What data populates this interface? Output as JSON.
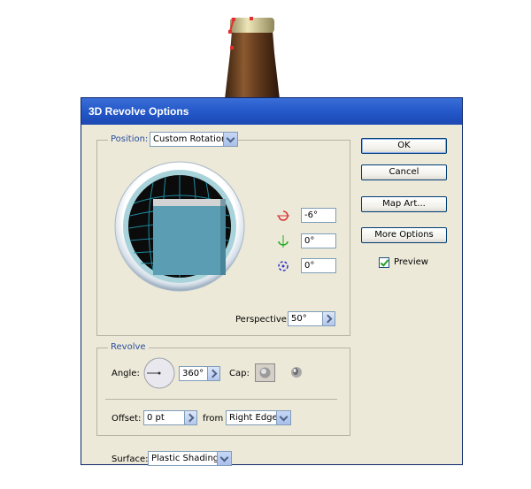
{
  "dialog": {
    "title": "3D Revolve Options"
  },
  "position": {
    "label": "Position:",
    "preset": "Custom Rotation",
    "x_rotation": "-6°",
    "y_rotation": "0°",
    "z_rotation": "0°",
    "perspective_label": "Perspective:",
    "perspective_value": "50°"
  },
  "buttons": {
    "ok": "OK",
    "cancel": "Cancel",
    "map_art": "Map Art...",
    "more_options": "More Options"
  },
  "preview": {
    "label": "Preview",
    "checked": true
  },
  "revolve": {
    "legend": "Revolve",
    "angle_label": "Angle:",
    "angle_value": "360°",
    "cap_label": "Cap:",
    "offset_label": "Offset:",
    "offset_value": "0 pt",
    "from_label": "from",
    "from_value": "Right Edge"
  },
  "surface": {
    "label": "Surface:",
    "value": "Plastic Shading"
  },
  "colors": {
    "titlebar": "#2458C9",
    "dialog_bg": "#ECE9D8",
    "legend_text": "#2B4F9C",
    "preview_cube": "#5B9EB4"
  }
}
